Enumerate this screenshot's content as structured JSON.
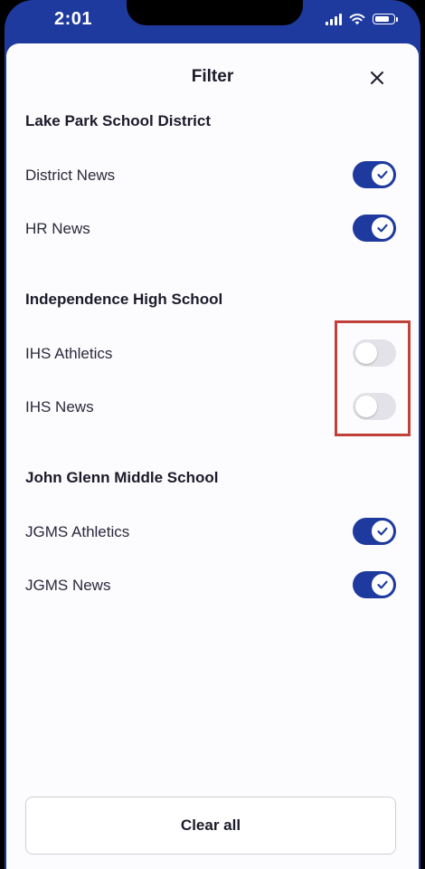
{
  "status_bar": {
    "time": "2:01"
  },
  "sheet": {
    "title": "Filter",
    "close_icon": "close-icon"
  },
  "sections": [
    {
      "heading": "Lake Park School District",
      "items": [
        {
          "label": "District News",
          "enabled": true
        },
        {
          "label": "HR News",
          "enabled": true
        }
      ]
    },
    {
      "heading": "Independence High School",
      "items": [
        {
          "label": "IHS Athletics",
          "enabled": false
        },
        {
          "label": "IHS News",
          "enabled": false
        }
      ]
    },
    {
      "heading": "John Glenn Middle School",
      "items": [
        {
          "label": "JGMS Athletics",
          "enabled": true
        },
        {
          "label": "JGMS News",
          "enabled": true
        }
      ]
    }
  ],
  "footer": {
    "clear_all_label": "Clear all"
  },
  "colors": {
    "accent": "#1e3a9e",
    "toggle_off": "#e3e2e8",
    "highlight": "#c0413a",
    "sheet_bg": "#fcfbfd"
  }
}
